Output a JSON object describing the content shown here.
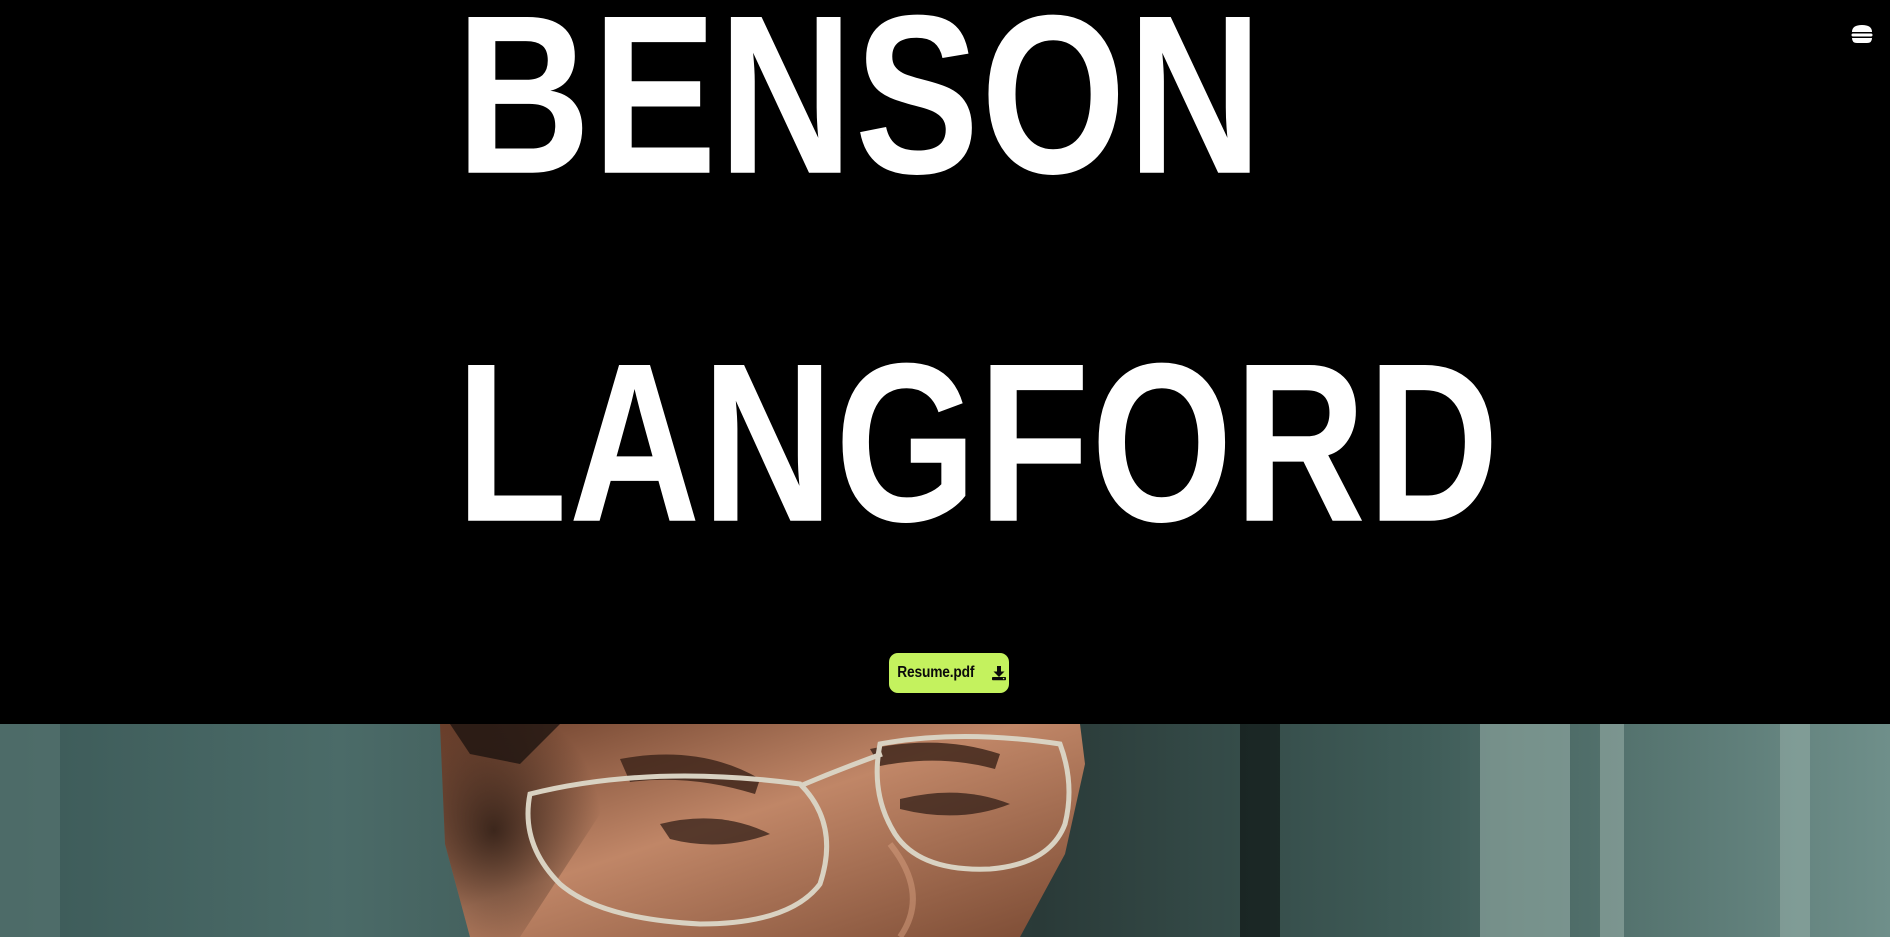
{
  "hero": {
    "first_name": "BENSON",
    "last_name": "LANGFORD"
  },
  "nav": {
    "menu_icon": "hamburger-menu-icon"
  },
  "resume_button": {
    "label": "Resume.pdf",
    "icon": "download-icon"
  },
  "colors": {
    "background": "#000000",
    "name_text": "#ffffff",
    "accent": "#c4f25e"
  },
  "portrait": {
    "subject": "portrait-photo"
  }
}
